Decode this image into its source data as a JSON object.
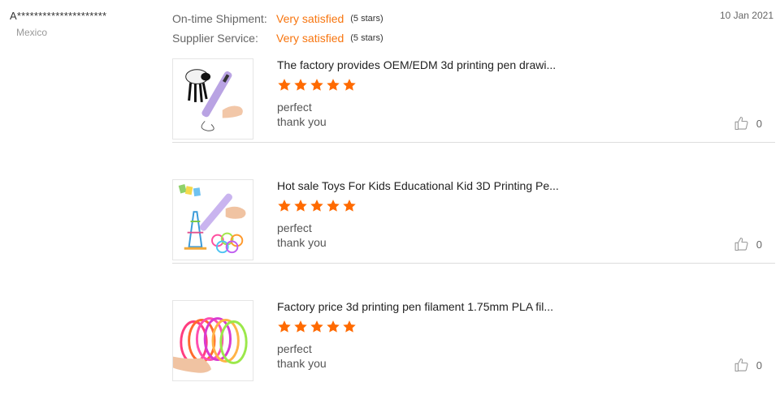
{
  "reviewer": {
    "name": "A*********************",
    "country": "Mexico"
  },
  "ratings": [
    {
      "label": "On-time Shipment:",
      "value": "Very satisfied",
      "stars_text": "(5 stars)"
    },
    {
      "label": "Supplier Service:",
      "value": "Very satisfied",
      "stars_text": "(5 stars)"
    }
  ],
  "date": "10 Jan 2021",
  "colors": {
    "accent": "#f7750f",
    "star": "#ff6a00",
    "divider": "#dddddd"
  },
  "reviews": [
    {
      "title": "The factory provides OEM/EDM 3d printing pen drawi...",
      "stars": 5,
      "comment_line1": "perfect",
      "comment_line2": "thank you",
      "likes": "0",
      "thumb_icon": "3d-pen-sheep-thumbnail"
    },
    {
      "title": "Hot sale Toys For Kids Educational Kid 3D Printing Pe...",
      "stars": 5,
      "comment_line1": "perfect",
      "comment_line2": "thank you",
      "likes": "0",
      "thumb_icon": "3d-pen-eiffel-thumbnail"
    },
    {
      "title": "Factory price 3d printing pen filament 1.75mm PLA fil...",
      "stars": 5,
      "comment_line1": "perfect",
      "comment_line2": "thank you",
      "likes": "0",
      "thumb_icon": "filament-coils-thumbnail"
    }
  ]
}
